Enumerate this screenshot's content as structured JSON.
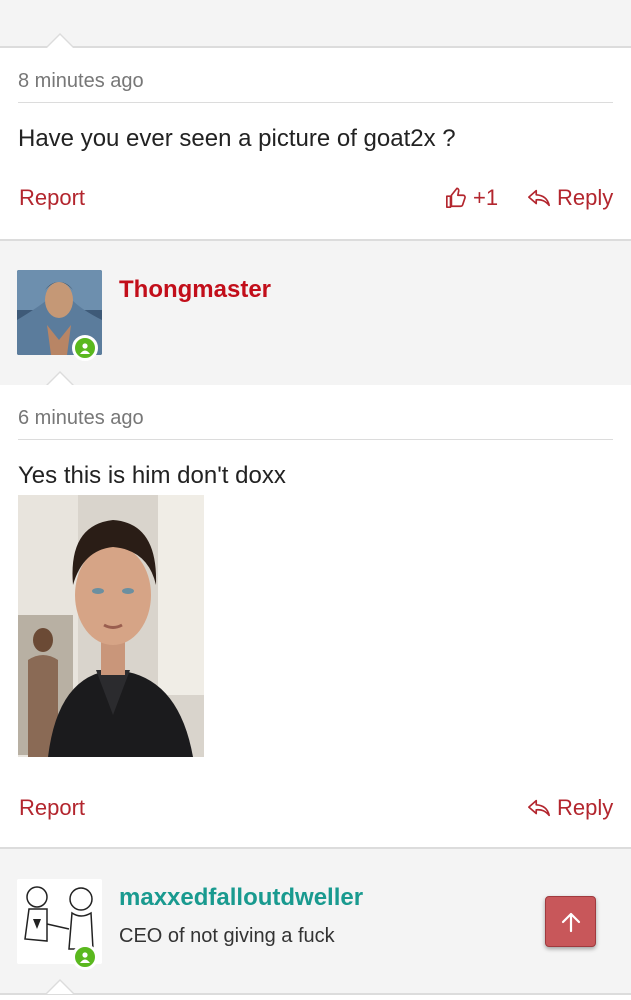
{
  "posts": [
    {
      "timestamp": "8 minutes ago",
      "message": "Have you ever seen a picture of goat2x ?",
      "report_label": "Report",
      "like_count": "+1",
      "reply_label": "Reply"
    },
    {
      "author": "Thongmaster",
      "author_color": "#c20e1a",
      "timestamp": "6 minutes ago",
      "message": "Yes this is him don't doxx",
      "report_label": "Report",
      "reply_label": "Reply"
    }
  ],
  "next_user": {
    "name": "maxxedfalloutdweller",
    "name_color": "#199a8f",
    "title": "CEO of not giving a fuck"
  },
  "icons": {
    "online": "user-online-icon",
    "like": "thumbs-up-icon",
    "reply": "reply-arrow-icon",
    "scroll_top": "arrow-up-icon"
  },
  "colors": {
    "accent": "#b3262e",
    "online": "#5ab81e",
    "scroll_button": "#c8575a"
  }
}
